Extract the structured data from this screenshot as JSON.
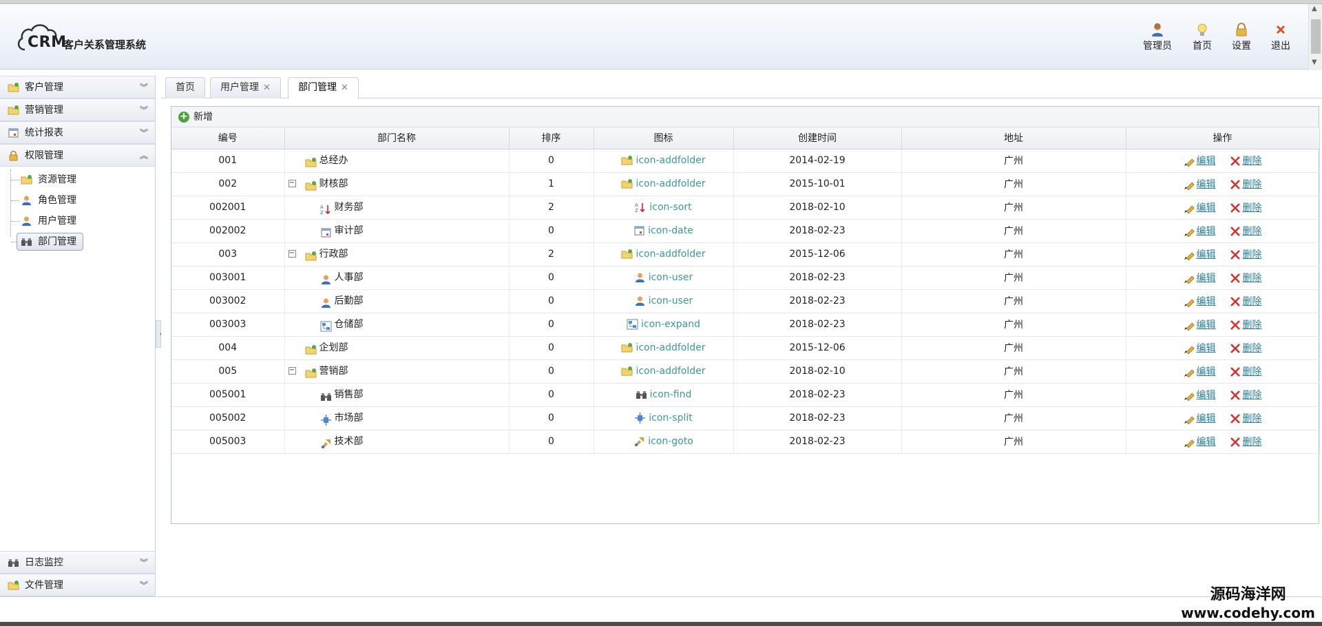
{
  "header": {
    "logo_text": "CRM",
    "app_title": "客户关系管理系统",
    "buttons": [
      {
        "label": "管理员",
        "icon": "user-icon"
      },
      {
        "label": "首页",
        "icon": "lightbulb-icon"
      },
      {
        "label": "设置",
        "icon": "lock-icon"
      },
      {
        "label": "退出",
        "icon": "close-icon"
      }
    ]
  },
  "sidebar": {
    "sections": [
      {
        "label": "客户管理",
        "icon": "folder-icon",
        "expanded": false
      },
      {
        "label": "营销管理",
        "icon": "folder-icon",
        "expanded": false
      },
      {
        "label": "统计报表",
        "icon": "date-icon",
        "expanded": false
      },
      {
        "label": "权限管理",
        "icon": "lock-icon",
        "expanded": true
      }
    ],
    "tree": [
      {
        "label": "资源管理",
        "icon": "folder-icon"
      },
      {
        "label": "角色管理",
        "icon": "user-icon"
      },
      {
        "label": "用户管理",
        "icon": "user-icon"
      },
      {
        "label": "部门管理",
        "icon": "find-icon",
        "selected": true
      }
    ],
    "bottom_sections": [
      {
        "label": "日志监控",
        "icon": "find-icon"
      },
      {
        "label": "文件管理",
        "icon": "folder-icon"
      }
    ]
  },
  "tabs": [
    {
      "label": "首页",
      "closable": false
    },
    {
      "label": "用户管理",
      "closable": true
    },
    {
      "label": "部门管理",
      "closable": true,
      "active": true
    }
  ],
  "tab_close_glyph": "✕",
  "toolbar": {
    "add_label": "新增"
  },
  "table": {
    "columns": [
      "编号",
      "部门名称",
      "排序",
      "图标",
      "创建时间",
      "地址",
      "操作"
    ],
    "edit_label": "编辑",
    "delete_label": "删除",
    "rows": [
      {
        "id": "001",
        "name": "总经办",
        "level": 0,
        "expander": "",
        "sort": "0",
        "icon": "icon-addfolder",
        "created": "2014-02-19",
        "address": "广州"
      },
      {
        "id": "002",
        "name": "财核部",
        "level": 0,
        "expander": "−",
        "sort": "1",
        "icon": "icon-addfolder",
        "created": "2015-10-01",
        "address": "广州"
      },
      {
        "id": "002001",
        "name": "财务部",
        "level": 1,
        "expander": "",
        "sort": "2",
        "icon": "icon-sort",
        "created": "2018-02-10",
        "address": "广州"
      },
      {
        "id": "002002",
        "name": "审计部",
        "level": 1,
        "expander": "",
        "sort": "0",
        "icon": "icon-date",
        "created": "2018-02-23",
        "address": "广州"
      },
      {
        "id": "003",
        "name": "行政部",
        "level": 0,
        "expander": "−",
        "sort": "2",
        "icon": "icon-addfolder",
        "created": "2015-12-06",
        "address": "广州"
      },
      {
        "id": "003001",
        "name": "人事部",
        "level": 1,
        "expander": "",
        "sort": "0",
        "icon": "icon-user",
        "created": "2018-02-23",
        "address": "广州"
      },
      {
        "id": "003002",
        "name": "后勤部",
        "level": 1,
        "expander": "",
        "sort": "0",
        "icon": "icon-user",
        "created": "2018-02-23",
        "address": "广州"
      },
      {
        "id": "003003",
        "name": "仓储部",
        "level": 1,
        "expander": "",
        "sort": "0",
        "icon": "icon-expand",
        "created": "2018-02-23",
        "address": "广州"
      },
      {
        "id": "004",
        "name": "企划部",
        "level": 0,
        "expander": "",
        "sort": "0",
        "icon": "icon-addfolder",
        "created": "2015-12-06",
        "address": "广州"
      },
      {
        "id": "005",
        "name": "营销部",
        "level": 0,
        "expander": "−",
        "sort": "0",
        "icon": "icon-addfolder",
        "created": "2018-02-10",
        "address": "广州"
      },
      {
        "id": "005001",
        "name": "销售部",
        "level": 1,
        "expander": "",
        "sort": "0",
        "icon": "icon-find",
        "created": "2018-02-23",
        "address": "广州"
      },
      {
        "id": "005002",
        "name": "市场部",
        "level": 1,
        "expander": "",
        "sort": "0",
        "icon": "icon-split",
        "created": "2018-02-23",
        "address": "广州"
      },
      {
        "id": "005003",
        "name": "技术部",
        "level": 1,
        "expander": "",
        "sort": "0",
        "icon": "icon-goto",
        "created": "2018-02-23",
        "address": "广州"
      }
    ]
  },
  "watermark": {
    "line1": "源码海洋网",
    "line2": "www.codehy.com"
  }
}
